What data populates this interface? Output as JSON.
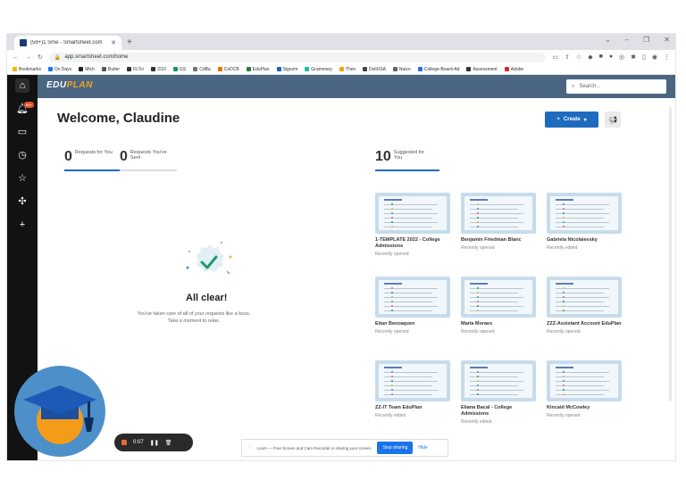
{
  "browser": {
    "tab_title": "(59+)1 Sme - Smartsheet.com",
    "url": "app.smartsheet.com/home",
    "bookmarks": [
      "Bookmarks",
      "Ox Days",
      "Mtch",
      "Butler",
      "FLTcr",
      "2/10",
      "GS",
      "CdBa",
      "CoDCB",
      "EduPlan",
      "Signzm",
      "Grammary",
      "Thes",
      "DellUSA",
      "Naivo",
      "College-Board-Ad",
      "Assessment",
      "Adobe"
    ]
  },
  "rail": {
    "notification_badge": "99+"
  },
  "header": {
    "logo_edu": "EDU",
    "logo_plan": "PLAN",
    "search_placeholder": "Search..."
  },
  "main": {
    "welcome": "Welcome, Claudine",
    "create_label": "Create",
    "requests_for_you": {
      "count": "0",
      "label": "Requests for You"
    },
    "requests_sent": {
      "count": "0",
      "label": "Requests You've Sent"
    },
    "suggested": {
      "count": "10",
      "label": "Suggested for You"
    },
    "all_clear_title": "All clear!",
    "all_clear_sub": "You've taken care of all of your requests like a boss. Take a moment to relax."
  },
  "cards": [
    {
      "name": "1-TEMPLATE 2022 - College Admissions",
      "status": "Recently opened"
    },
    {
      "name": "Benjamin Friedman Blanc",
      "status": "Recently opened"
    },
    {
      "name": "Gabriela Nicolaievsky",
      "status": "Recently edited"
    },
    {
      "name": "Eitan Benzaquen",
      "status": "Recently opened"
    },
    {
      "name": "Maria Moraes",
      "status": "Recently opened"
    },
    {
      "name": "ZZZ-Assistant Account EduPlan",
      "status": "Recently opened"
    },
    {
      "name": "ZZ-IT Team EduPlan",
      "status": "Recently edited"
    },
    {
      "name": "Eliana Bacal - College Admissions",
      "status": "Recently edited"
    },
    {
      "name": "Kincaid McCowley",
      "status": "Recently opened"
    }
  ],
  "recorder": {
    "timer": "0:07",
    "share_text": "Loom — Free Screen and Cam Recorder is sharing your screen.",
    "stop_label": "Stop sharing",
    "hide_label": "Hide"
  },
  "colors": {
    "header": "#4b6682",
    "accent": "#1f6bc0",
    "rail": "#121212",
    "card_thumb": "#c6dcec"
  }
}
